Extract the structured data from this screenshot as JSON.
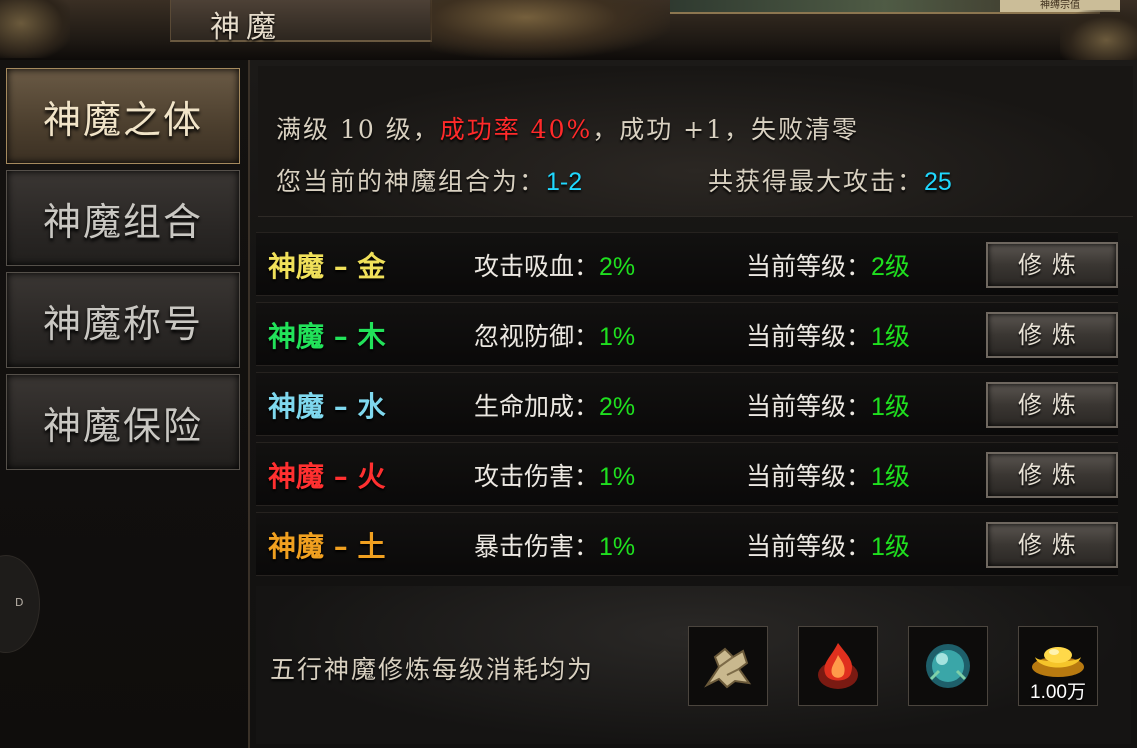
{
  "header": {
    "title": "神魔",
    "right_tag": "神缚宗值"
  },
  "sidebar": {
    "items": [
      {
        "label": "神魔之体",
        "active": true
      },
      {
        "label": "神魔组合",
        "active": false
      },
      {
        "label": "神魔称号",
        "active": false
      },
      {
        "label": "神魔保险",
        "active": false
      }
    ],
    "round_button_label": "D"
  },
  "info": {
    "line1_prefix": "满级 10 级，",
    "line1_rate": "成功率 40%",
    "line1_suffix": "，成功 +1，失败清零",
    "combo_label": "您当前的神魔组合为：",
    "combo_value": "1-2",
    "attack_label": "共获得最大攻击：",
    "attack_value": "25"
  },
  "colors": {
    "gold": "#f0e05a",
    "wood": "#22e25a",
    "water": "#7fd8ee",
    "fire": "#ff3030",
    "earth": "#f0a020",
    "value_green": "#1fe01f",
    "value_cyan": "#20d8ff",
    "rate_red": "#ff2a2a"
  },
  "rows": [
    {
      "name": "神魔 – 金",
      "color": "#f0e05a",
      "attr_label": "攻击吸血：",
      "attr_value": "2%",
      "level_label": "当前等级：",
      "level_value": "2级",
      "button": "修炼"
    },
    {
      "name": "神魔 – 木",
      "color": "#22e25a",
      "attr_label": "忽视防御：",
      "attr_value": "1%",
      "level_label": "当前等级：",
      "level_value": "1级",
      "button": "修炼"
    },
    {
      "name": "神魔 – 水",
      "color": "#7fd8ee",
      "attr_label": "生命加成：",
      "attr_value": "2%",
      "level_label": "当前等级：",
      "level_value": "1级",
      "button": "修炼"
    },
    {
      "name": "神魔 – 火",
      "color": "#ff3030",
      "attr_label": "攻击伤害：",
      "attr_value": "1%",
      "level_label": "当前等级：",
      "level_value": "1级",
      "button": "修炼"
    },
    {
      "name": "神魔 – 土",
      "color": "#f0a020",
      "attr_label": "暴击伤害：",
      "attr_value": "1%",
      "level_label": "当前等级：",
      "level_value": "1级",
      "button": "修炼"
    }
  ],
  "cost": {
    "label": "五行神魔修炼每级消耗均为",
    "items": [
      {
        "icon": "bone-material-icon"
      },
      {
        "icon": "flame-crystal-icon"
      },
      {
        "icon": "jade-orb-icon"
      },
      {
        "icon": "gold-ingot-icon",
        "amount": "1.00万"
      }
    ]
  }
}
